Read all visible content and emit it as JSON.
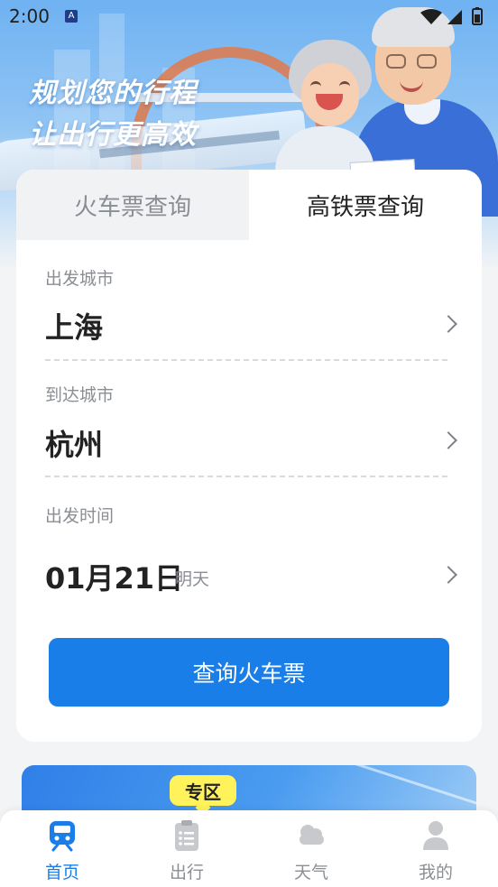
{
  "status_bar": {
    "time": "2:00",
    "notification_letter": "A"
  },
  "hero": {
    "slogan_line1": "规划您的行程",
    "slogan_line2": "让出行更高效"
  },
  "tabs": [
    {
      "label": "火车票查询",
      "active": false
    },
    {
      "label": "高铁票查询",
      "active": true
    }
  ],
  "form": {
    "departure": {
      "label": "出发城市",
      "value": "上海"
    },
    "arrival": {
      "label": "到达城市",
      "value": "杭州"
    },
    "date": {
      "label": "出发时间",
      "value": "01月21日",
      "sub": "明天"
    }
  },
  "query_button": "查询火车票",
  "banner": {
    "badge": "专区"
  },
  "bottom_nav": [
    {
      "label": "首页",
      "icon": "train-icon",
      "active": true
    },
    {
      "label": "出行",
      "icon": "clipboard-icon",
      "active": false
    },
    {
      "label": "天气",
      "icon": "cloud-icon",
      "active": false
    },
    {
      "label": "我的",
      "icon": "person-icon",
      "active": false
    }
  ],
  "colors": {
    "accent": "#1a7ee8",
    "badge": "#fff25a",
    "muted_text": "#8b8e94"
  }
}
